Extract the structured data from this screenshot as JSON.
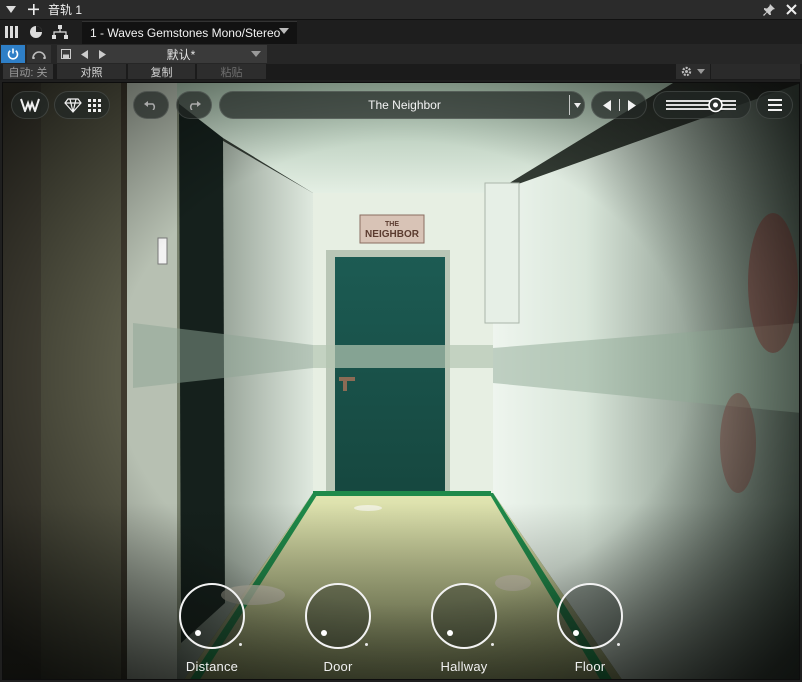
{
  "window": {
    "title": "音轨 1",
    "preset_tab": "1 - Waves Gemstones Mono/Stereo"
  },
  "host": {
    "preset_name": "默认*",
    "auto_label": "自动: 关",
    "compare_label": "对照",
    "copy_label": "复制",
    "paste_label": "粘贴"
  },
  "plugin": {
    "preset_name": "The Neighbor",
    "sign_text": "THE NEIGHBOR",
    "output_level": 0.75,
    "knobs": [
      {
        "label": "Distance",
        "value": 0.0
      },
      {
        "label": "Door",
        "value": 0.0
      },
      {
        "label": "Hallway",
        "value": 0.0
      },
      {
        "label": "Floor",
        "value": 0.0
      }
    ]
  },
  "colors": {
    "power_active": "#2e7fc7",
    "door": "#1e5a52",
    "floor_trim": "#1f8a4a"
  }
}
